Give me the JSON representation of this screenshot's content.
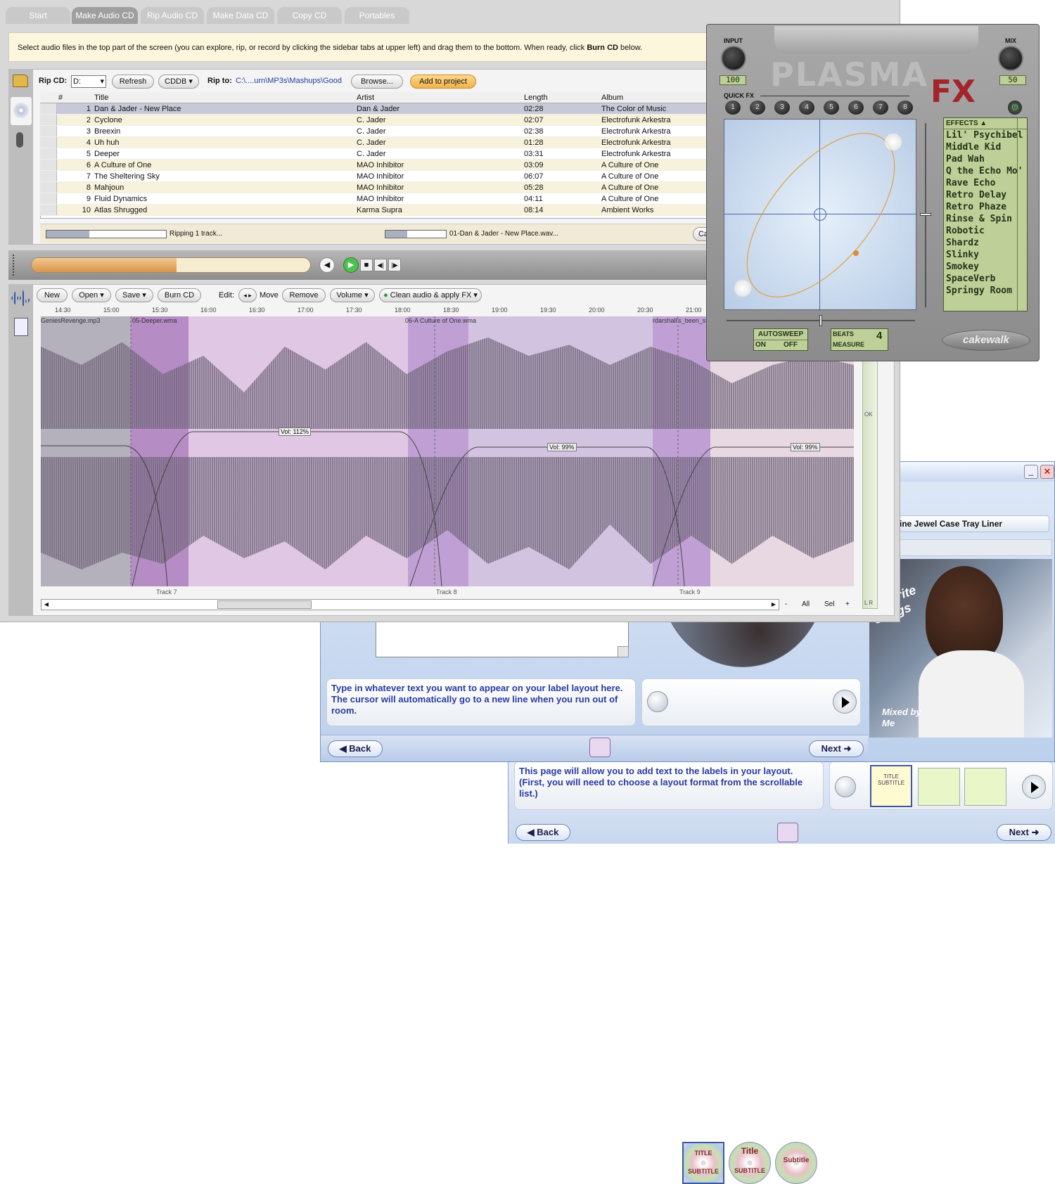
{
  "tabs": [
    "Start",
    "Make Audio CD",
    "Rip Audio CD",
    "Make Data CD",
    "Copy CD",
    "Portables"
  ],
  "instruction": {
    "before": "Select audio files in the top part of the screen (you can explore, rip, or record by clicking the sidebar tabs at upper left) and drag them to the bottom. When ready, click ",
    "bold": "Burn CD",
    "after": " below."
  },
  "rip": {
    "label": "Rip CD:",
    "drive": "D:",
    "refresh": "Refresh",
    "cddb": "CDDB",
    "rip_to_label": "Rip to:",
    "path": "C:\\....urn\\MP3s\\Mashups\\Good",
    "browse": "Browse...",
    "add": "Add to project",
    "progress_label": "Ripping 1 track...",
    "file_label": "01-Dan & Jader - New Place.wav...",
    "cancel": "Ca"
  },
  "table": {
    "headers": [
      "#",
      "Title",
      "Artist",
      "Length",
      "Album"
    ],
    "rows": [
      [
        "1",
        "Dan & Jader - New Place",
        "Dan & Jader",
        "02:28",
        "The Color of Music"
      ],
      [
        "2",
        "Cyclone",
        "C. Jader",
        "02:07",
        "Electrofunk Arkestra"
      ],
      [
        "3",
        "Breexin",
        "C. Jader",
        "02:38",
        "Electrofunk Arkestra"
      ],
      [
        "4",
        "Uh huh",
        "C. Jader",
        "01:28",
        "Electrofunk Arkestra"
      ],
      [
        "5",
        "Deeper",
        "C. Jader",
        "03:31",
        "Electrofunk Arkestra"
      ],
      [
        "6",
        "A Culture of One",
        "MAO Inhibitor",
        "03:09",
        "A Culture of One"
      ],
      [
        "7",
        "The Sheltering Sky",
        "MAO Inhibitor",
        "06:07",
        "A Culture of One"
      ],
      [
        "8",
        "Mahjoun",
        "MAO Inhibitor",
        "05:28",
        "A Culture of One"
      ],
      [
        "9",
        "Fluid Dynamics",
        "MAO Inhibitor",
        "04:11",
        "A Culture of One"
      ],
      [
        "10",
        "Atlas Shrugged",
        "Karma Supra",
        "08:14",
        "Ambient Works"
      ]
    ]
  },
  "editor": {
    "new": "New",
    "open": "Open",
    "save": "Save",
    "burn": "Burn CD",
    "edit_label": "Edit:",
    "move": "Move",
    "remove": "Remove",
    "volume": "Volume",
    "clean": "Clean audio & apply FX",
    "timeline": [
      "14:30",
      "15:00",
      "15:30",
      "16:00",
      "16:30",
      "17:00",
      "17:30",
      "18:00",
      "18:30",
      "19:00",
      "19:30",
      "20:00",
      "20:30",
      "21:00"
    ],
    "clips": [
      "GeniesRevenge.mp3",
      "05-Deeper.wma",
      "06-A Culture of One.wma",
      "rdarshall's_been_sn"
    ],
    "volumes": [
      "Vol: 112%",
      "Vol: 99%",
      "Vol: 99%"
    ],
    "tracks": [
      "Track 7",
      "Track 8",
      "Track 9"
    ],
    "zoom": [
      "-",
      "All",
      "Sel",
      "+"
    ],
    "meter_ok": "OK",
    "meter_lr": "L R"
  },
  "plasma": {
    "input_label": "INPUT",
    "input_value": "100",
    "mix_label": "MIX",
    "mix_value": "50",
    "logo": "PLASMA",
    "logo_fx": "FX",
    "quick_fx": "QUICK FX",
    "quick_buttons": [
      "1",
      "2",
      "3",
      "4",
      "5",
      "6",
      "7",
      "8"
    ],
    "effects_label": "EFFECTS",
    "effects": [
      "Lil' Psychibel",
      "Middle Kid",
      "Pad Wah",
      "Q the Echo Mo'",
      "Rave Echo",
      "Retro Delay",
      "Retro Phaze",
      "Rinse & Spin",
      "Robotic",
      "Shardz",
      "Slinky",
      "Smokey",
      "SpaceVerb",
      "Springy Room"
    ],
    "autosweep": "AUTOSWEEP",
    "on": "ON",
    "off": "OFF",
    "beats": "BEATS",
    "measure": "MEASURE",
    "beats_value": "4",
    "brand": "cakewalk"
  },
  "label_wizard": {
    "jewel_title": "ine Jewel Case Tray Liner",
    "cover_text": "Favorite Songs",
    "mixed_by": "Mixed by Me",
    "help1": "Type in whatever text you want to appear on your label layout here. The cursor will automatically go to a new line when you run out of room.",
    "back": "Back",
    "next": "Next",
    "help2": "This page will allow you to add text to the labels in your layout. (First, you will need to choose a layout format from the scrollable list.)",
    "cd_title": "TITLE",
    "cd_subtitle": "SUBTITLE",
    "cd_title2": "Title",
    "cd_subtitle2": "Subtitle"
  }
}
